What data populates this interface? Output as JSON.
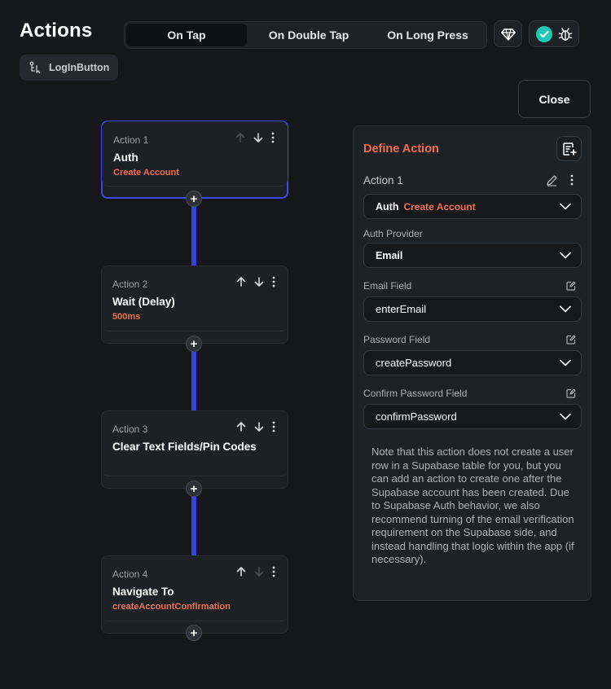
{
  "header": {
    "title": "Actions",
    "tabs": [
      {
        "label": "On Tap",
        "active": true
      },
      {
        "label": "On Double Tap",
        "active": false
      },
      {
        "label": "On Long Press",
        "active": false
      }
    ],
    "widget_chip": "LogInButton",
    "close_label": "Close"
  },
  "colors": {
    "accent": "#4247e6",
    "highlight": "#f2704f",
    "success": "#1fc8b4",
    "background": "#15171b"
  },
  "actions": [
    {
      "label": "Action 1",
      "name": "Auth",
      "sub": "Create Account"
    },
    {
      "label": "Action 2",
      "name": "Wait (Delay)",
      "sub": "500ms"
    },
    {
      "label": "Action 3",
      "name": "Clear Text Fields/Pin Codes",
      "sub": ""
    },
    {
      "label": "Action 4",
      "name": "Navigate To",
      "sub": "createAccountConfirmation"
    }
  ],
  "panel": {
    "title": "Define Action",
    "action_label": "Action 1",
    "action_type": "Auth",
    "action_subtype": "Create Account",
    "auth_provider": {
      "label": "Auth Provider",
      "value": "Email"
    },
    "email_field": {
      "label": "Email Field",
      "value": "enterEmail"
    },
    "password_field": {
      "label": "Password Field",
      "value": "createPassword"
    },
    "confirm_password_field": {
      "label": "Confirm Password Field",
      "value": "confirmPassword"
    },
    "note": "Note that this action does not create a user row in a Supabase table for you, but you can add an action to create one after the Supabase account has been created. Due to Supabase Auth behavior, we also recommend turning of the email verification requirement on the Supabase side, and instead handling that logic within the app (if necessary)."
  }
}
